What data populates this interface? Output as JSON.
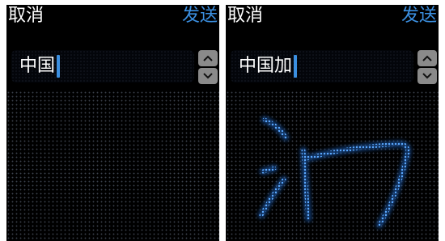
{
  "screens": [
    {
      "cancel_label": "取消",
      "send_label": "发送",
      "input_value": "中国"
    },
    {
      "cancel_label": "取消",
      "send_label": "发送",
      "input_value": "中国加"
    }
  ],
  "colors": {
    "accent": "#3b8fe0",
    "background": "#000000",
    "stepper": "#8a8a8a",
    "stroke_glow": "#2a6fd0"
  },
  "icons": {
    "stepper_up": "chevron-up-icon",
    "stepper_down": "chevron-down-icon"
  }
}
